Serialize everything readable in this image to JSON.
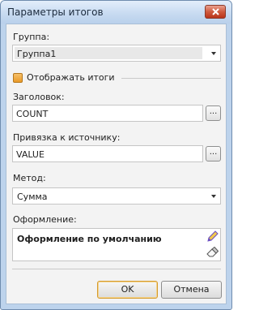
{
  "window": {
    "title": "Параметры итогов",
    "close_icon": "close-x-icon"
  },
  "group": {
    "label": "Группа:",
    "value": "Группа1"
  },
  "show_totals": {
    "label": "Отображать итоги",
    "checked": true,
    "color": "#e99a28"
  },
  "caption": {
    "label": "Заголовок:",
    "value": "COUNT",
    "browse_label": "..."
  },
  "source": {
    "label": "Привязка к источнику:",
    "value": "VALUE",
    "browse_label": "..."
  },
  "method": {
    "label": "Метод:",
    "value": "Сумма"
  },
  "style": {
    "label": "Оформление:",
    "value": "Оформление по умолчанию",
    "edit_icon": "pencil-icon",
    "clear_icon": "eraser-icon"
  },
  "buttons": {
    "ok": "OK",
    "cancel": "Отмена"
  }
}
